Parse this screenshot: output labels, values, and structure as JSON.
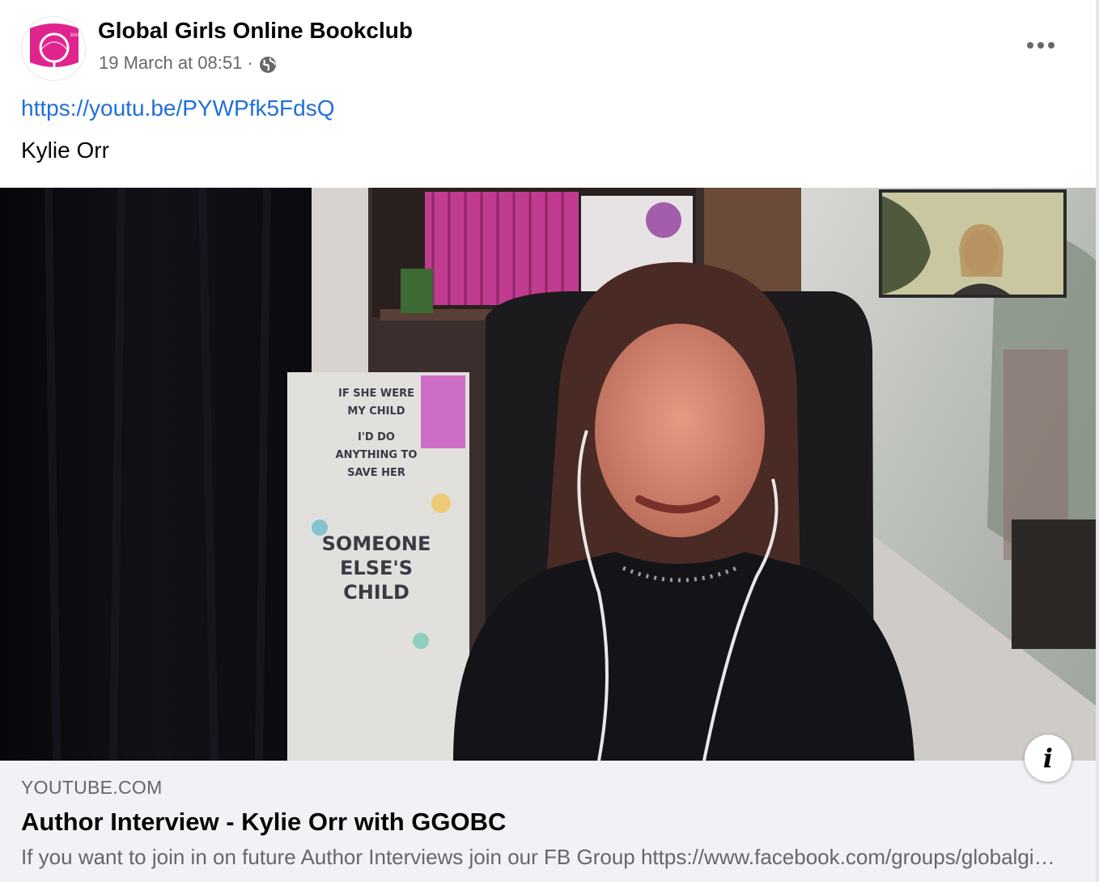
{
  "post": {
    "page_name": "Global Girls Online Bookclub",
    "timestamp": "19 March at 08:51",
    "separator": "·",
    "audience_icon": "globe-icon",
    "more_icon": "more-options-icon",
    "link_text": "https://youtu.be/PYWPfk5FdsQ",
    "body_text": "Kylie Orr"
  },
  "avatar": {
    "logo_text": "Global Girls Online Book Club",
    "brand_color": "#e0248f"
  },
  "video": {
    "thumbnail_icon": "video-thumbnail",
    "book_cover_text": [
      "IF SHE WERE",
      "MY CHILD",
      "I'D DO",
      "ANYTHING TO",
      "SAVE HER",
      "SOMEONE",
      "ELSE'S",
      "CHILD"
    ],
    "info_symbol": "i"
  },
  "preview": {
    "domain": "YOUTUBE.COM",
    "title": "Author Interview - Kylie Orr with GGOBC",
    "description": "If you want to join in on future Author Interviews join our FB Group https://www.facebook.com/groups/globalgirlsonlinebookclub"
  },
  "colors": {
    "link": "#216fdb",
    "text_primary": "#050505",
    "text_secondary": "#65676b",
    "preview_bg": "#f0f2f5"
  }
}
